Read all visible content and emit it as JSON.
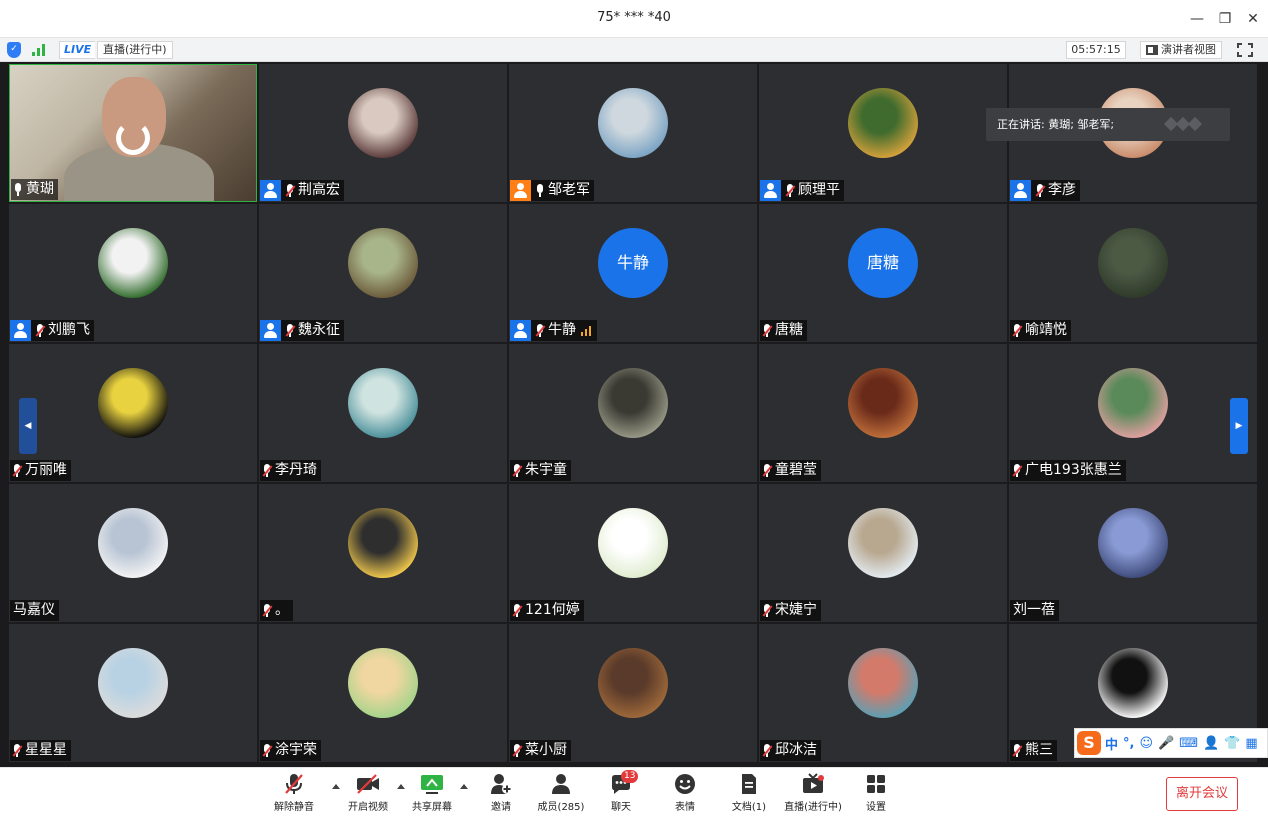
{
  "window": {
    "title": "75* *** *40",
    "minimize": "—",
    "restore": "❐",
    "close": "✕"
  },
  "statusbar": {
    "shield_glyph": "✓",
    "live": "LIVE",
    "live_state": "直播(进行中)",
    "elapsed": "05:57:15",
    "speaker_view": "演讲者视图"
  },
  "speaking_toast": "正在讲话: 黄瑚; 邹老军;",
  "participants": [
    {
      "name": "黄瑚",
      "host": "none",
      "muted": false,
      "avatar": "video"
    },
    {
      "name": "荆高宏",
      "host": "blue",
      "muted": true,
      "avatar": "photo",
      "colors": [
        "#5a3a3a",
        "#d9c9c0"
      ]
    },
    {
      "name": "邹老军",
      "host": "orange",
      "muted": false,
      "avatar": "photo",
      "colors": [
        "#7aa3c4",
        "#cfd8de"
      ]
    },
    {
      "name": "顾理平",
      "host": "blue",
      "muted": true,
      "avatar": "photo",
      "colors": [
        "#d7a23b",
        "#3f6b2e"
      ]
    },
    {
      "name": "李彦",
      "host": "blue",
      "muted": true,
      "avatar": "photo",
      "colors": [
        "#c98b6a",
        "#e8d2c0"
      ]
    },
    {
      "name": "刘鹏飞",
      "host": "blue",
      "muted": true,
      "avatar": "photo",
      "colors": [
        "#2f6b2a",
        "#f2f2f2"
      ]
    },
    {
      "name": "魏永征",
      "host": "blue",
      "muted": true,
      "avatar": "photo",
      "colors": [
        "#6b5a3a",
        "#a8b48a"
      ]
    },
    {
      "name": "牛静",
      "host": "blue",
      "muted": true,
      "avatar": "text",
      "volume": true
    },
    {
      "name": "唐糖",
      "host": "none",
      "muted": true,
      "avatar": "text"
    },
    {
      "name": "喻靖悦",
      "host": "none",
      "muted": true,
      "avatar": "photo",
      "colors": [
        "#2f3a2a",
        "#4c5a44"
      ]
    },
    {
      "name": "万丽唯",
      "host": "none",
      "muted": true,
      "avatar": "photo",
      "colors": [
        "#0c0c0c",
        "#e8d240"
      ]
    },
    {
      "name": "李丹琦",
      "host": "none",
      "muted": true,
      "avatar": "photo",
      "colors": [
        "#4a8f9a",
        "#cfe3e0"
      ]
    },
    {
      "name": "朱宇童",
      "host": "none",
      "muted": true,
      "avatar": "photo",
      "colors": [
        "#9a9a88",
        "#3a3a33"
      ]
    },
    {
      "name": "童碧莹",
      "host": "none",
      "muted": true,
      "avatar": "photo",
      "colors": [
        "#c0703a",
        "#6a2a1a"
      ]
    },
    {
      "name": "广电193张惠兰",
      "host": "none",
      "muted": true,
      "avatar": "photo",
      "colors": [
        "#e0a0a0",
        "#5a8a5a"
      ]
    },
    {
      "name": "马嘉仪",
      "host": "none",
      "muted": false,
      "avatar": "photo",
      "colors": [
        "#f4f4f4",
        "#b8c4d4"
      ]
    },
    {
      "name": "。",
      "host": "none",
      "muted": true,
      "avatar": "photo",
      "colors": [
        "#f2c94c",
        "#2e2e2e"
      ]
    },
    {
      "name": "121何婷",
      "host": "none",
      "muted": true,
      "avatar": "photo",
      "colors": [
        "#dfeccf",
        "#ffffff"
      ]
    },
    {
      "name": "宋婕宁",
      "host": "none",
      "muted": true,
      "avatar": "photo",
      "colors": [
        "#e4ecf2",
        "#b8a890"
      ]
    },
    {
      "name": "刘一蓓",
      "host": "none",
      "muted": false,
      "avatar": "photo",
      "colors": [
        "#3d4a7a",
        "#8a9ad4"
      ]
    },
    {
      "name": "星星星",
      "host": "none",
      "muted": true,
      "avatar": "photo",
      "colors": [
        "#dcdcdc",
        "#b8d2e4"
      ]
    },
    {
      "name": "涂宇荣",
      "host": "none",
      "muted": true,
      "avatar": "photo",
      "colors": [
        "#a4d48a",
        "#f0d6a0"
      ]
    },
    {
      "name": "菜小厨",
      "host": "none",
      "muted": true,
      "avatar": "photo",
      "colors": [
        "#a06a3a",
        "#5a3a2a"
      ]
    },
    {
      "name": "邱冰洁",
      "host": "none",
      "muted": true,
      "avatar": "photo",
      "colors": [
        "#5aa0b4",
        "#d47a6a"
      ]
    },
    {
      "name": "熊三",
      "host": "none",
      "muted": true,
      "avatar": "photo",
      "colors": [
        "#ffffff",
        "#111111"
      ]
    }
  ],
  "nav": {
    "prev": "◀",
    "next": "▶"
  },
  "ime": {
    "logo": "S",
    "items": [
      "中",
      "°,",
      "☺",
      "🎤",
      "⌨",
      "👤",
      "👕",
      "▦"
    ]
  },
  "toolbar": {
    "unmute": "解除静音",
    "start_video": "开启视频",
    "share_screen": "共享屏幕",
    "invite": "邀请",
    "members": "成员(285)",
    "chat": "聊天",
    "chat_badge": "13",
    "emoji": "表情",
    "docs": "文档(1)",
    "live": "直播(进行中)",
    "settings": "设置",
    "leave": "离开会议"
  },
  "colors": {
    "accent": "#1a73e8",
    "host_orange": "#ff7f16",
    "danger": "#e23b3b",
    "active_border": "#2fb344"
  }
}
